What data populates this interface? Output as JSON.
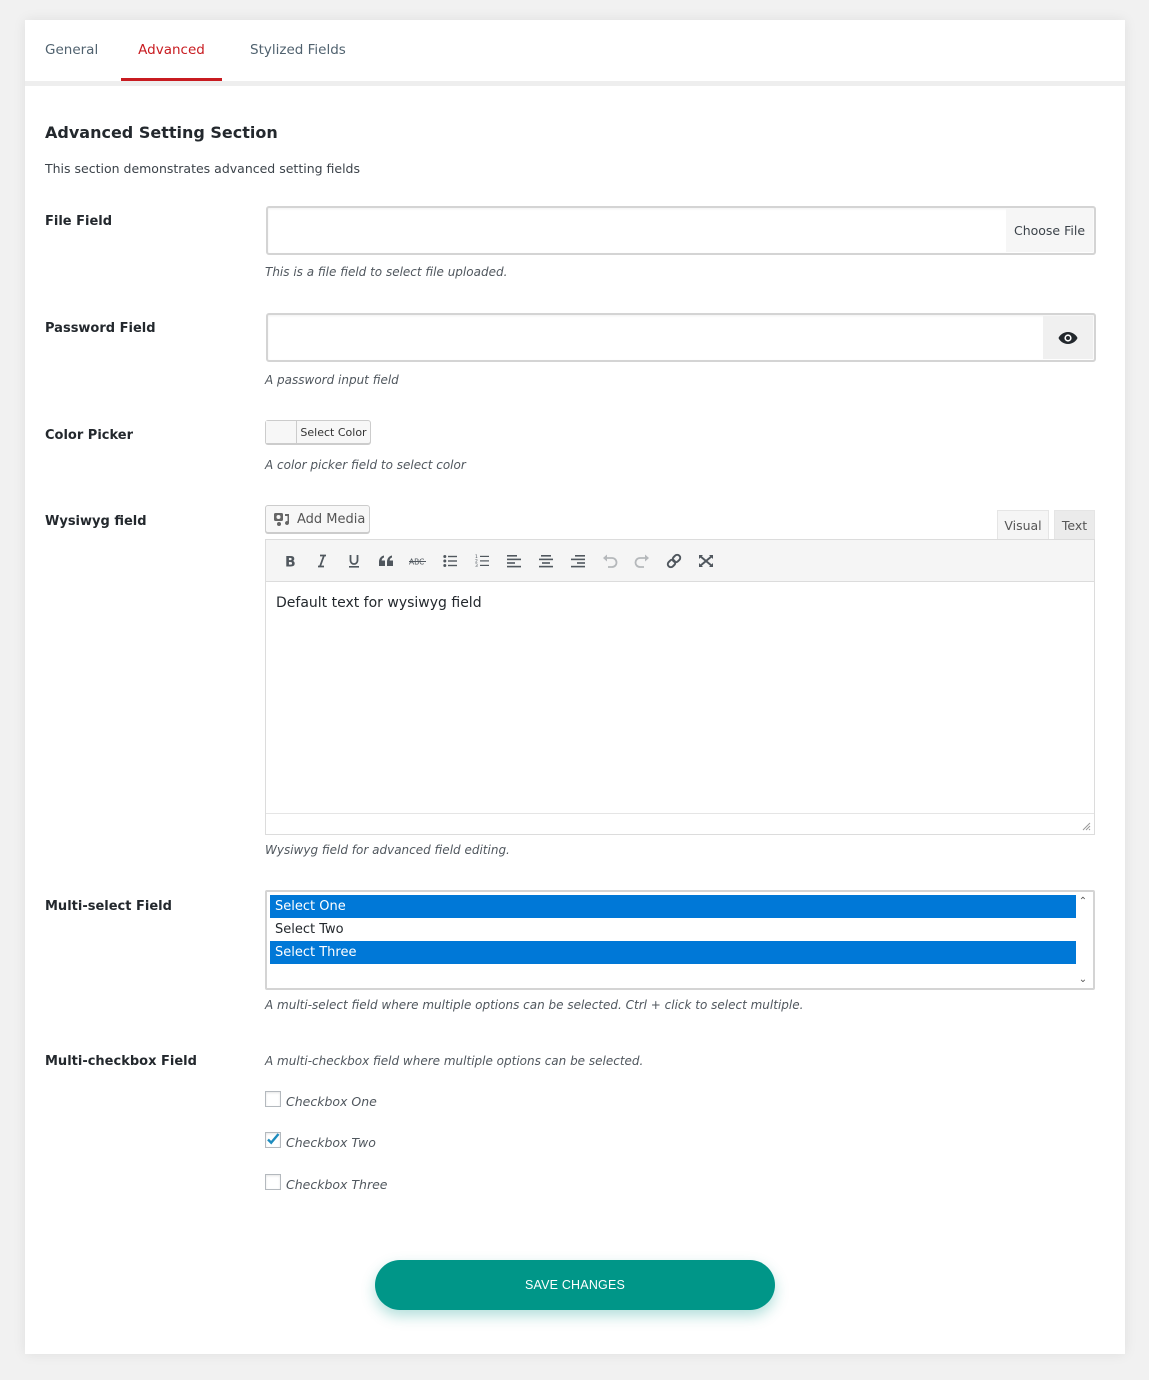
{
  "tabs": [
    {
      "label": "General",
      "active": false
    },
    {
      "label": "Advanced",
      "active": true
    },
    {
      "label": "Stylized Fields",
      "active": false
    }
  ],
  "section": {
    "title": "Advanced Setting Section",
    "description": "This section demonstrates advanced setting fields"
  },
  "fields": {
    "file": {
      "label": "File Field",
      "value": "",
      "button_label": "Choose File",
      "hint": "This is a file field to select file uploaded."
    },
    "password": {
      "label": "Password Field",
      "value": "",
      "toggle_icon": "eye-icon",
      "hint": "A password input field"
    },
    "color": {
      "label": "Color Picker",
      "button_label": "Select Color",
      "hint": "A color picker field to select color"
    },
    "wysiwyg": {
      "label": "Wysiwyg field",
      "add_media_label": "Add Media",
      "tab_visual": "Visual",
      "tab_text": "Text",
      "active_tab": "Visual",
      "toolbar": [
        "bold",
        "italic",
        "underline",
        "blockquote",
        "strikethrough",
        "bullet-list",
        "numbered-list",
        "align-left",
        "align-center",
        "align-right",
        "undo",
        "redo",
        "link",
        "fullscreen"
      ],
      "content": "Default text for wysiwyg field",
      "hint": "Wysiwyg field for advanced field editing."
    },
    "multiselect": {
      "label": "Multi-select Field",
      "options": [
        {
          "label": "Select One",
          "selected": true
        },
        {
          "label": "Select Two",
          "selected": false
        },
        {
          "label": "Select Three",
          "selected": true
        }
      ],
      "hint": "A multi-select field where multiple options can be selected. Ctrl + click to select multiple."
    },
    "multicheck": {
      "label": "Multi-checkbox Field",
      "hint": "A multi-checkbox field where multiple options can be selected.",
      "options": [
        {
          "label": "Checkbox One",
          "checked": false
        },
        {
          "label": "Checkbox Two",
          "checked": true
        },
        {
          "label": "Checkbox Three",
          "checked": false
        }
      ]
    }
  },
  "save_button": {
    "label": "SAVE CHANGES"
  },
  "colors": {
    "active_tab": "#c81b20",
    "save_button": "#009688",
    "selected_option": "#0078d7",
    "checkmark": "#1e8cbe"
  }
}
